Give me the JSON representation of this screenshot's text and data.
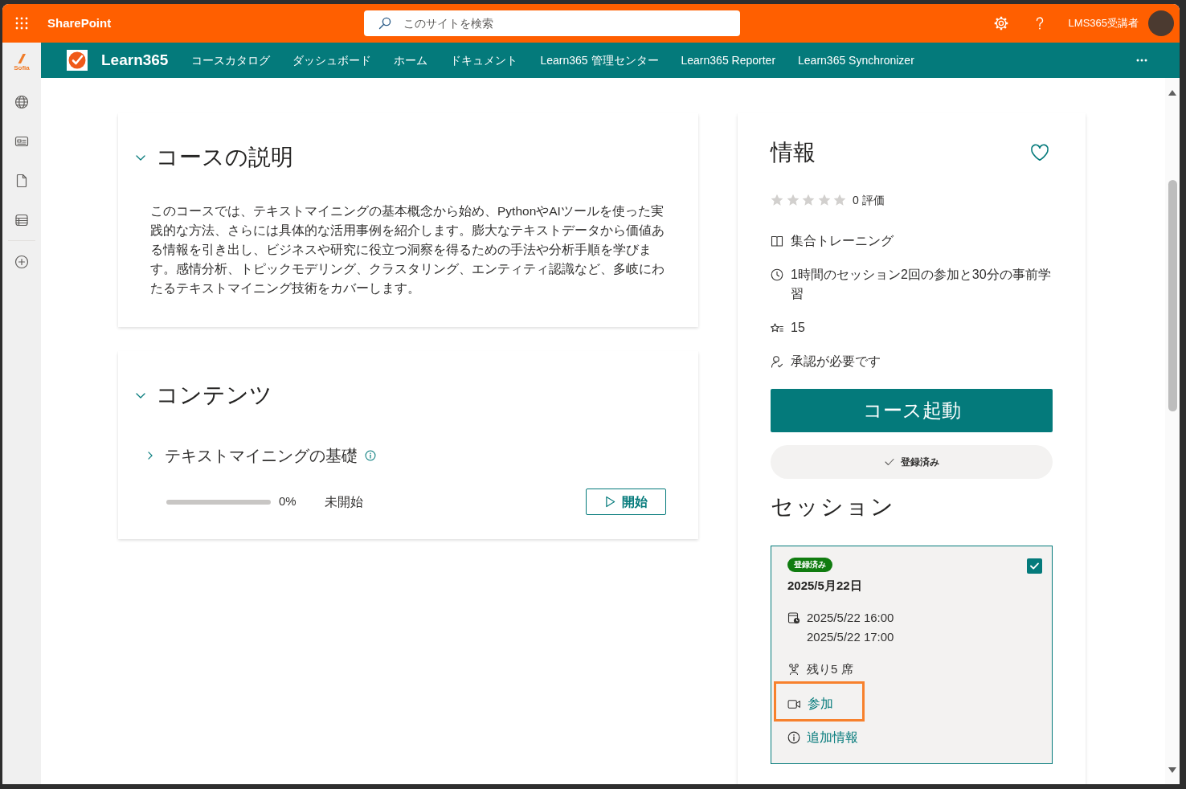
{
  "top_bar": {
    "app_name": "SharePoint",
    "search": {
      "placeholder": "このサイトを検索"
    },
    "user_name": "LMS365受講者"
  },
  "left_rail": {
    "logo_text": "Sofia"
  },
  "site_nav": {
    "site_name": "Learn365",
    "items": [
      "コースカタログ",
      "ダッシュボード",
      "ホーム",
      "ドキュメント",
      "Learn365 管理センター",
      "Learn365 Reporter",
      "Learn365 Synchronizer"
    ]
  },
  "description": {
    "title": "コースの説明",
    "expanded": true,
    "text": "このコースでは、テキストマイニングの基本概念から始め、PythonやAIツールを使った実践的な方法、さらには具体的な活用事例を紹介します。膨大なテキストデータから価値ある情報を引き出し、ビジネスや研究に役立つ洞察を得るための手法や分析手順を学びます。感情分析、トピックモデリング、クラスタリング、エンティティ認識など、多岐にわたるテキストマイニング技術をカバーします。"
  },
  "contents": {
    "title": "コンテンツ",
    "expanded": true,
    "modules": [
      {
        "title": "テキストマイニングの基礎",
        "expanded": false,
        "level": 0,
        "progress_text": "0%",
        "status": "未開始",
        "action": "開始"
      }
    ]
  },
  "info": {
    "title": "情報",
    "favorited": false,
    "stars": 0,
    "rating_text": "0 評価",
    "details": [
      {
        "kind": "format",
        "text": "集合トレーニング"
      },
      {
        "kind": "duration",
        "text": "1時間のセッション2回の参加と30分の事前学習"
      },
      {
        "kind": "points",
        "text": "15"
      },
      {
        "kind": "approval",
        "text": "承認が必要です"
      }
    ],
    "launch_button": "コース起動",
    "enrolled_button": "登録済み",
    "sessions_title": "セッション",
    "sessions": [
      {
        "badge": "登録済み",
        "checked": true,
        "date": "2025/5月22日",
        "start": "2025/5/22 16:00",
        "end": "2025/5/22 17:00",
        "seats": "残り5 席",
        "links": [
          {
            "kind": "join",
            "label": "参加",
            "highlighted": true
          },
          {
            "kind": "info",
            "label": "追加情報",
            "highlighted": false
          }
        ]
      }
    ]
  }
}
